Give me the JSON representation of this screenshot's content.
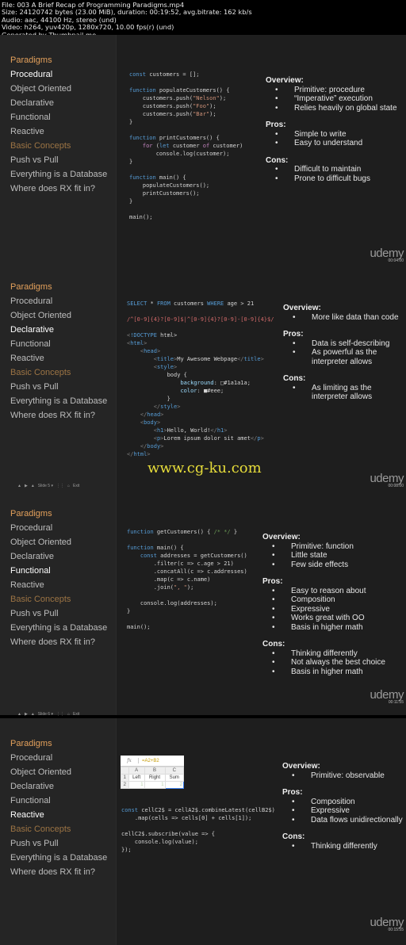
{
  "file_info": {
    "lines": [
      "File: 003 A Brief Recap of Programming Paradigms.mp4",
      "Size: 24120742 bytes (23.00 MiB), duration: 00:19:52, avg.bitrate: 162 kb/s",
      "Audio: aac, 44100 Hz, stereo (und)",
      "Video: h264, yuv420p, 1280x720, 10.00 fps(r) (und)",
      "Generated by Thumbnail me"
    ]
  },
  "nav": {
    "items": [
      {
        "label": "Paradigms",
        "type": "section"
      },
      {
        "label": "Procedural",
        "type": "item"
      },
      {
        "label": "Object Oriented",
        "type": "item"
      },
      {
        "label": "Declarative",
        "type": "item"
      },
      {
        "label": "Functional",
        "type": "item"
      },
      {
        "label": "Reactive",
        "type": "item"
      },
      {
        "label": "Basic Concepts",
        "type": "section-dim"
      },
      {
        "label": "Push vs Pull",
        "type": "item"
      },
      {
        "label": "Everything is a Database",
        "type": "item"
      },
      {
        "label": "Where does RX fit in?",
        "type": "item"
      }
    ]
  },
  "brand": {
    "logo": "udemy"
  },
  "watermark": "www.cg-ku.com",
  "frames": [
    {
      "active": "Procedural",
      "timestamp": "00:04:00",
      "player": null,
      "notes": {
        "overview_label": "Overview:",
        "overview": [
          "Primitive: procedure",
          "“Imperative” execution",
          "Relies heavily on global state"
        ],
        "pros_label": "Pros:",
        "pros": [
          "Simple to write",
          "Easy to understand"
        ],
        "cons_label": "Cons:",
        "cons": [
          "Difficult to maintain",
          "Prone to difficult bugs"
        ]
      }
    },
    {
      "active": "Declarative",
      "timestamp": "00:08:00",
      "player": {
        "slide": "Slide 5 ▾",
        "exit": "Exit"
      },
      "notes": {
        "overview_label": "Overview:",
        "overview": [
          "More like data than code"
        ],
        "pros_label": "Pros:",
        "pros": [
          "Data is self-describing",
          "As powerful as the interpreter allows"
        ],
        "cons_label": "Cons:",
        "cons": [
          "As limiting as the interpreter allows"
        ]
      }
    },
    {
      "active": "Functional",
      "timestamp": "00:11:55",
      "player": {
        "slide": "Slide 6 ▾",
        "exit": "Exit"
      },
      "notes": {
        "overview_label": "Overview:",
        "overview": [
          "Primitive: function",
          "Little state",
          "Few side effects"
        ],
        "pros_label": "Pros:",
        "pros": [
          "Easy to reason about",
          "Composition",
          "Expressive",
          "Works great with OO",
          "Basis in higher math"
        ],
        "cons_label": "Cons:",
        "cons": [
          "Thinking differently",
          "Not always the best choice",
          "Basis in higher math"
        ]
      }
    },
    {
      "active": "Reactive",
      "timestamp": "00:15:55",
      "player": null,
      "spreadsheet": {
        "formula": "=A2+B2",
        "col_headers": [
          "",
          "A",
          "B",
          "C"
        ],
        "rows": [
          [
            "1",
            "Left",
            "Right",
            "Sum"
          ],
          [
            "2",
            "1",
            "1",
            "2"
          ]
        ]
      },
      "notes": {
        "overview_label": "Overview:",
        "overview": [
          "Primitive: observable"
        ],
        "pros_label": "Pros:",
        "pros": [
          "Composition",
          "Expressive",
          "Data flows unidirectionally"
        ],
        "cons_label": "Cons:",
        "cons": [
          "Thinking differently"
        ]
      }
    }
  ],
  "code": {
    "procedural": [
      "const customers = [];",
      "",
      "function populateCustomers() {",
      "    customers.push(\"Nelson\");",
      "    customers.push(\"Foo\");",
      "    customers.push(\"Bar\");",
      "}",
      "",
      "function printCustomers() {",
      "    for (let customer of customer)",
      "        console.log(customer);",
      "}",
      "",
      "function main() {",
      "    populateCustomers();",
      "    printCustomers();",
      "}",
      "",
      "main();"
    ],
    "declarative": [
      "SELECT * FROM customers WHERE age > 21",
      "",
      "/^[0-9]{4}?[0-9]$|^[0-9]{4}?[0-9]-[0-9]{4}$/",
      "",
      "<!DOCTYPE html>",
      "<html>",
      "    <head>",
      "        <title>My Awesome Webpage</title>",
      "        <style>",
      "            body {",
      "                background: □#1a1a1a;",
      "                color: ■#eee;",
      "            }",
      "        </style>",
      "    </head>",
      "    <body>",
      "        <h1>Hello, World!</h1>",
      "        <p>Lorem ipsum dolor sit amet</p>",
      "    </body>",
      "</html>"
    ],
    "functional": [
      "function getCustomers() { /* */ }",
      "",
      "function main() {",
      "    const addresses = getCustomers()",
      "        .filter(c => c.age > 21)",
      "        .concatAll(c => c.addresses)",
      "        .map(c => c.name)",
      "        .join(\", \");",
      "",
      "    console.log(addresses);",
      "}",
      "",
      "main();"
    ],
    "reactive": [
      "const cellC2$ = cellA2$.combineLatest(cellB2$)",
      "    .map(cells => cells[0] + cells[1]);",
      "",
      "cellC2$.subscribe(value => {",
      "    console.log(value);",
      "});"
    ]
  }
}
